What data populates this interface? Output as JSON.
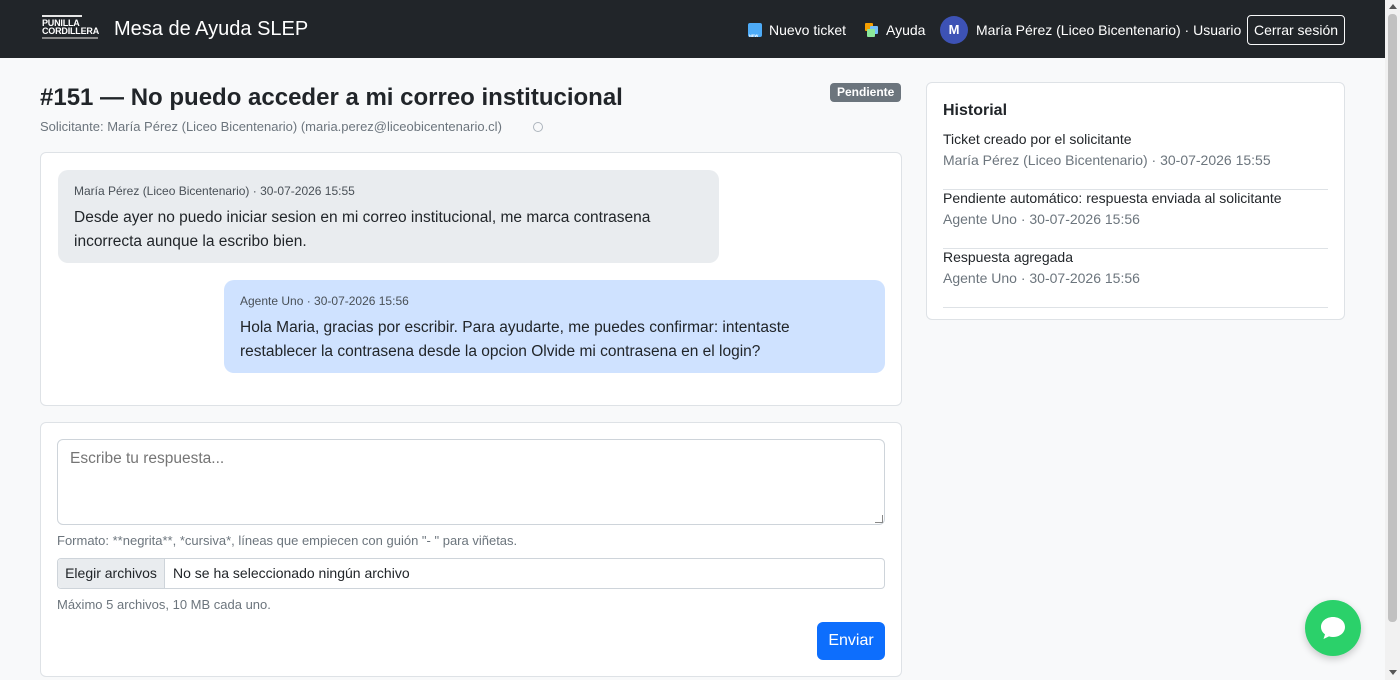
{
  "navbar": {
    "logo_line1": "PUNILLA",
    "logo_line2": "CORDILLERA",
    "brand": "Mesa de Ayuda SLEP",
    "new_ticket": "Nuevo ticket",
    "help": "Ayuda",
    "avatar_initial": "M",
    "user_label": "María Pérez (Liceo Bicentenario) · Usuario",
    "logout": "Cerrar sesión"
  },
  "ticket": {
    "title": "#151 — No puedo acceder a mi correo institucional",
    "status": "Pendiente",
    "requester": "Solicitante: María Pérez (Liceo Bicentenario) (maria.perez@liceobicentenario.cl)"
  },
  "messages": [
    {
      "meta": "María Pérez (Liceo Bicentenario) · 30-07-2026 15:55",
      "text": "Desde ayer no puedo iniciar sesion en mi correo institucional, me marca contrasena incorrecta aunque la escribo bien."
    },
    {
      "meta": "Agente Uno · 30-07-2026 15:56",
      "text": "Hola Maria, gracias por escribir. Para ayudarte, me puedes confirmar: intentaste restablecer la contrasena desde la opcion Olvide mi contrasena en el login?"
    }
  ],
  "reply": {
    "placeholder": "Escribe tu respuesta...",
    "format_hint": "Formato: **negrita**, *cursiva*, líneas que empiecen con guión \"- \" para viñetas.",
    "file_button": "Elegir archivos",
    "file_status": "No se ha seleccionado ningún archivo",
    "limit_hint": "Máximo 5 archivos, 10 MB cada uno.",
    "send": "Enviar"
  },
  "history": {
    "title": "Historial",
    "items": [
      {
        "event": "Ticket creado por el solicitante",
        "meta": "María Pérez (Liceo Bicentenario) · 30-07-2026 15:55"
      },
      {
        "event": "Pendiente automático: respuesta enviada al solicitante",
        "meta": "Agente Uno · 30-07-2026 15:56"
      },
      {
        "event": "Respuesta agregada",
        "meta": "Agente Uno · 30-07-2026 15:56"
      }
    ]
  },
  "colors": {
    "navbar": "#212529",
    "primary": "#0d6efd",
    "badge": "#6c757d",
    "incoming_bubble": "#e9ecef",
    "outgoing_bubble": "#cfe2ff",
    "chat_fab": "#2bd16a"
  },
  "icons": {
    "new_ticket": "new-badge-icon",
    "help": "color-blocks-icon",
    "chat": "chat-bubble-icon"
  }
}
